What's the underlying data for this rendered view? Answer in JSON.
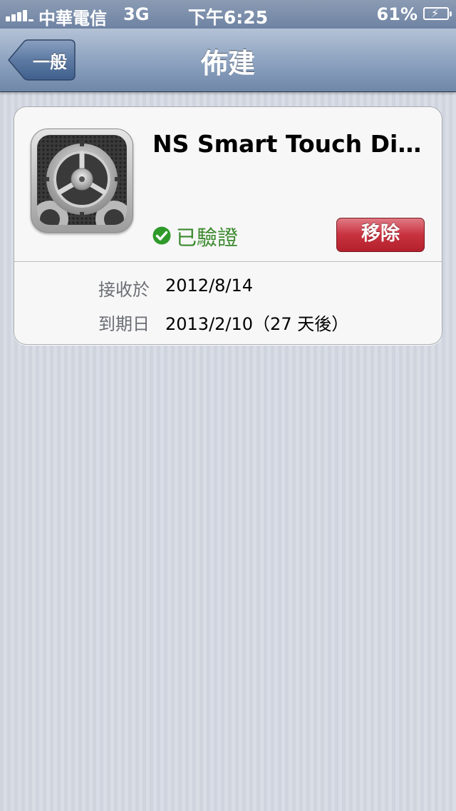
{
  "status_bar": {
    "carrier": "中華電信",
    "network": "3G",
    "time": "下午6:25",
    "battery_percent": "61%",
    "signal_bars": 4,
    "battery_level": 0.61
  },
  "nav": {
    "back_label": "一般",
    "title": "佈建"
  },
  "profile": {
    "name": "NS Smart Touch Di…",
    "icon": "settings-gear-icon",
    "verified_label": "已驗證",
    "verified_color": "#3c8a2e",
    "remove_label": "移除",
    "remove_color": "#c8323f",
    "details": [
      {
        "label": "接收於",
        "value": "2012/8/14"
      },
      {
        "label": "到期日",
        "value": "2013/2/10（27 天後）"
      }
    ]
  }
}
